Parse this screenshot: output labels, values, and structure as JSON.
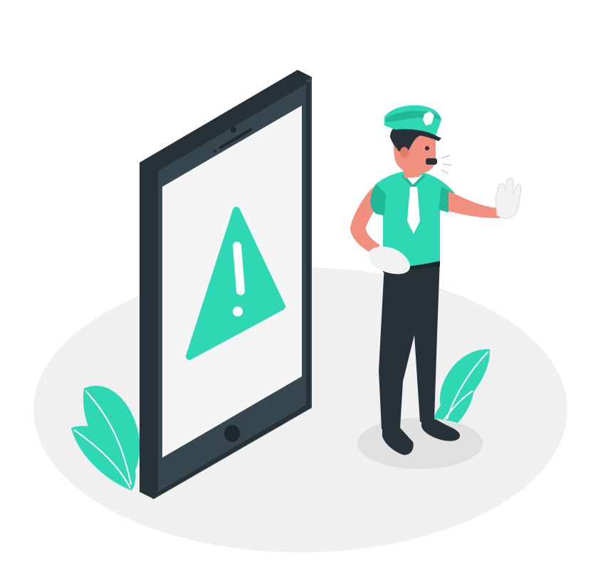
{
  "illustration": {
    "subject": "security-warning",
    "colors": {
      "background": "#ffffff",
      "floor": "#f0f0f0",
      "accent": "#2ed8b4",
      "accent_dark": "#20b896",
      "dark": "#263238",
      "dark_side": "#37474f",
      "screen": "#f5f5f5",
      "skin": "#f28f7e",
      "glove": "#f2f2f2"
    },
    "icons": [
      "tablet-device",
      "warning-triangle-icon",
      "police-officer",
      "whistle-icon",
      "leaf-plant"
    ]
  }
}
